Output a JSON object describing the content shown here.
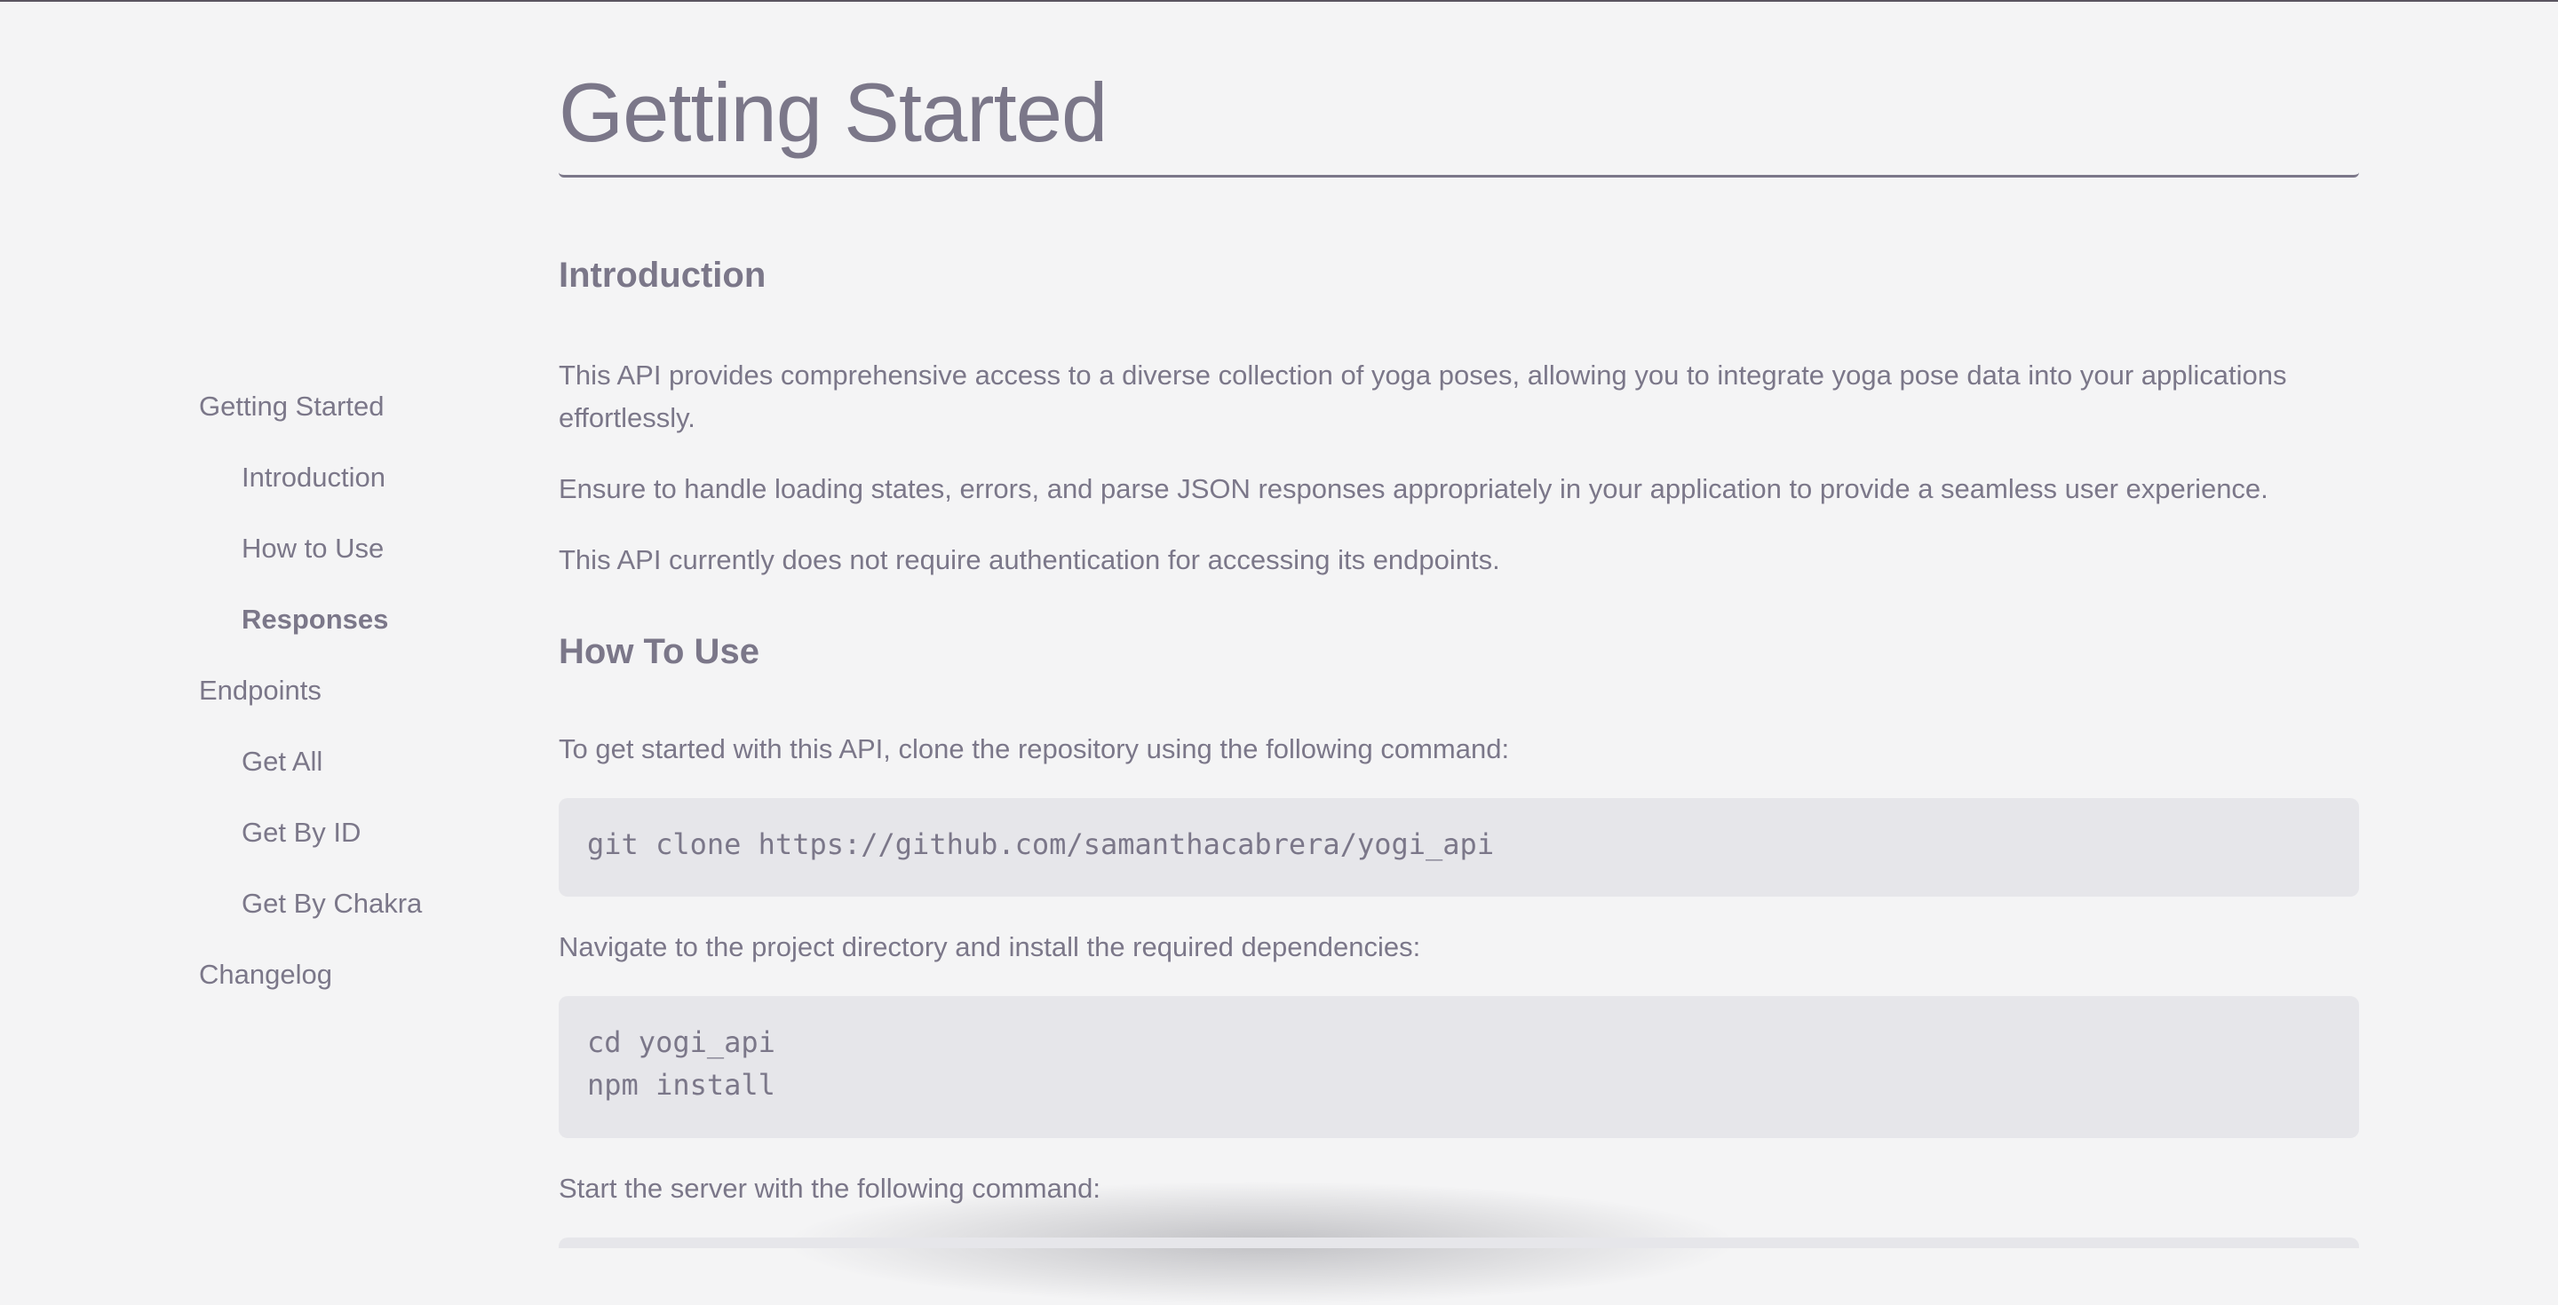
{
  "sidebar": {
    "items": [
      {
        "label": "Getting Started",
        "level": 0,
        "active": false
      },
      {
        "label": "Introduction",
        "level": 1,
        "active": false
      },
      {
        "label": "How to Use",
        "level": 1,
        "active": false
      },
      {
        "label": "Responses",
        "level": 1,
        "active": true
      },
      {
        "label": "Endpoints",
        "level": 0,
        "active": false
      },
      {
        "label": "Get All",
        "level": 1,
        "active": false
      },
      {
        "label": "Get By ID",
        "level": 1,
        "active": false
      },
      {
        "label": "Get By Chakra",
        "level": 1,
        "active": false
      },
      {
        "label": "Changelog",
        "level": 0,
        "active": false
      }
    ]
  },
  "main": {
    "title": "Getting Started",
    "introduction": {
      "heading": "Introduction",
      "paragraphs": [
        "This API provides comprehensive access to a diverse collection of yoga poses, allowing you to integrate yoga pose data into your applications effortlessly.",
        "Ensure to handle loading states, errors, and parse JSON responses appropriately in your application to provide a seamless user experience.",
        "This API currently does not require authentication for accessing its endpoints."
      ]
    },
    "how_to_use": {
      "heading": "How To Use",
      "step1_text": "To get started with this API, clone the repository using the following command:",
      "step1_code": "git clone https://github.com/samanthacabrera/yogi_api",
      "step2_text": "Navigate to the project directory and install the required dependencies:",
      "step2_code": "cd yogi_api\nnpm install",
      "step3_text": "Start the server with the following command:"
    }
  },
  "colors": {
    "background": "#f4f4f5",
    "text": "#7b7789",
    "code_background": "#e6e6ea"
  }
}
